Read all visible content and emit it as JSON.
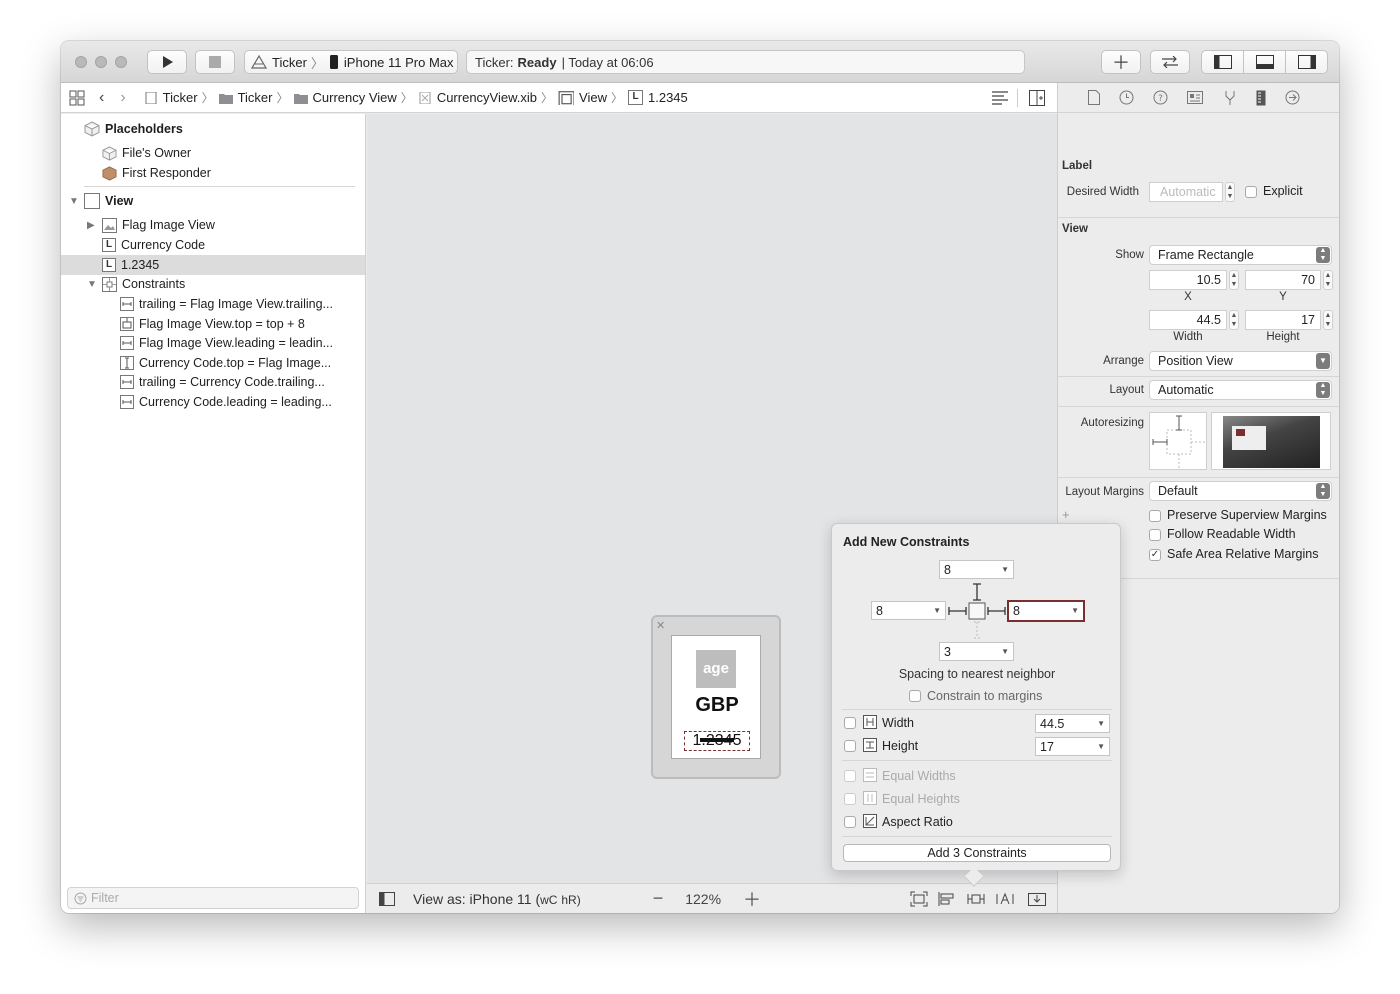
{
  "toolbar": {
    "scheme_target": "Ticker",
    "scheme_device": "iPhone 11 Pro Max",
    "status_app": "Ticker:",
    "status_state": "Ready",
    "status_time": "| Today at 06:06"
  },
  "jumpbar": {
    "crumbs": [
      "Ticker",
      "Ticker",
      "Currency View",
      "CurrencyView.xib",
      "View",
      "1.2345"
    ]
  },
  "navigator": {
    "placeholders_title": "Placeholders",
    "files_owner": "File's Owner",
    "first_responder": "First Responder",
    "view_label": "View",
    "flag_image_view": "Flag Image View",
    "currency_code": "Currency Code",
    "value_label": "1.2345",
    "constraints_label": "Constraints",
    "constraints": [
      "trailing = Flag Image View.trailing...",
      "Flag Image View.top = top + 8",
      "Flag Image View.leading = leadin...",
      "Currency Code.top = Flag Image...",
      "trailing = Currency Code.trailing...",
      "Currency Code.leading = leading..."
    ],
    "filter_placeholder": "Filter"
  },
  "canvas": {
    "image_text": "age",
    "currency_text": "GBP",
    "value_text": "1.2345",
    "view_as": "View as: iPhone 11 (",
    "size_class_w": "wC",
    "size_class_h": "hR)",
    "zoom": "122%"
  },
  "inspector": {
    "label_section": "Label",
    "desired_width_label": "Desired Width",
    "desired_width_value": "Automatic",
    "explicit_label": "Explicit",
    "view_section": "View",
    "show_label": "Show",
    "show_value": "Frame Rectangle",
    "x_value": "10.5",
    "y_value": "70",
    "x_label": "X",
    "y_label": "Y",
    "width_value": "44.5",
    "height_value": "17",
    "width_label": "Width",
    "height_label": "Height",
    "arrange_label": "Arrange",
    "arrange_value": "Position View",
    "layout_label": "Layout",
    "layout_value": "Automatic",
    "autoresizing_label": "Autoresizing",
    "layout_margins_label": "Layout Margins",
    "layout_margins_value": "Default",
    "preserve_margins": "Preserve Superview Margins",
    "follow_readable": "Follow Readable Width",
    "safe_area": "Safe Area Relative Margins"
  },
  "constraints_popover": {
    "title": "Add New Constraints",
    "top_value": "8",
    "left_value": "8",
    "right_value": "8",
    "bottom_value": "3",
    "spacing_caption": "Spacing to nearest neighbor",
    "constrain_margins": "Constrain to margins",
    "width_label": "Width",
    "width_value": "44.5",
    "height_label": "Height",
    "height_value": "17",
    "equal_widths": "Equal Widths",
    "equal_heights": "Equal Heights",
    "aspect_ratio": "Aspect Ratio",
    "add_button": "Add 3 Constraints"
  },
  "colors": {
    "accent": "#7a2e2e",
    "canvas_bg": "#e3e4e6"
  }
}
